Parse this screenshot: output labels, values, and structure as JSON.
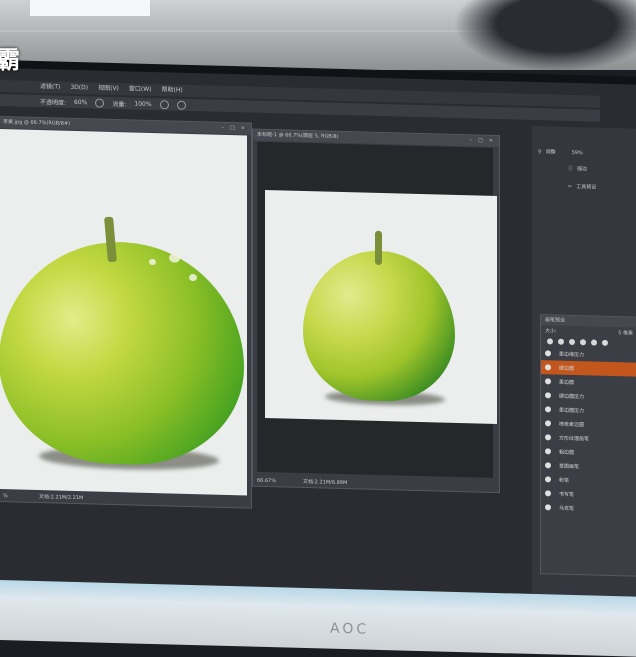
{
  "watermark": "霸",
  "brand": "AOC",
  "menus": [
    "滤镜(T)",
    "3D(D)",
    "视图(V)",
    "窗口(W)",
    "帮助(H)"
  ],
  "options": {
    "opacity_label": "不透明度:",
    "opacity": "60%",
    "flow_label": "流量:",
    "flow": "100%"
  },
  "doc_left": {
    "title": "苹果.jpg @ 66.7%(RGB/8#)",
    "status": "文档:2.21M/2.21M",
    "zoom": "%"
  },
  "doc_right": {
    "title": "未标题-1 @ 66.7%(图层 5, RGB/8)",
    "status": "文档:2.21M/6.89M",
    "zoom": "66.67%"
  },
  "properties": {
    "item1": "调整",
    "value1": "59%",
    "item2": "描边",
    "item3": "工具预设"
  },
  "brush_panel": {
    "title": "画笔预设",
    "size_label": "大小:",
    "size_value": "5 像素",
    "items": [
      "柔边缘压力",
      "硬边圆",
      "柔边圆",
      "硬边圆压力",
      "柔边圆压力",
      "喷枪柔边圆",
      "方形纹理画笔",
      "粗边圆",
      "草图画笔",
      "粉笔",
      "书写笔",
      "马克笔"
    ],
    "selected_index": 1
  },
  "colors": {
    "accent": "#c2561d",
    "panel": "#3b3e44",
    "canvas": "#eceeee"
  }
}
